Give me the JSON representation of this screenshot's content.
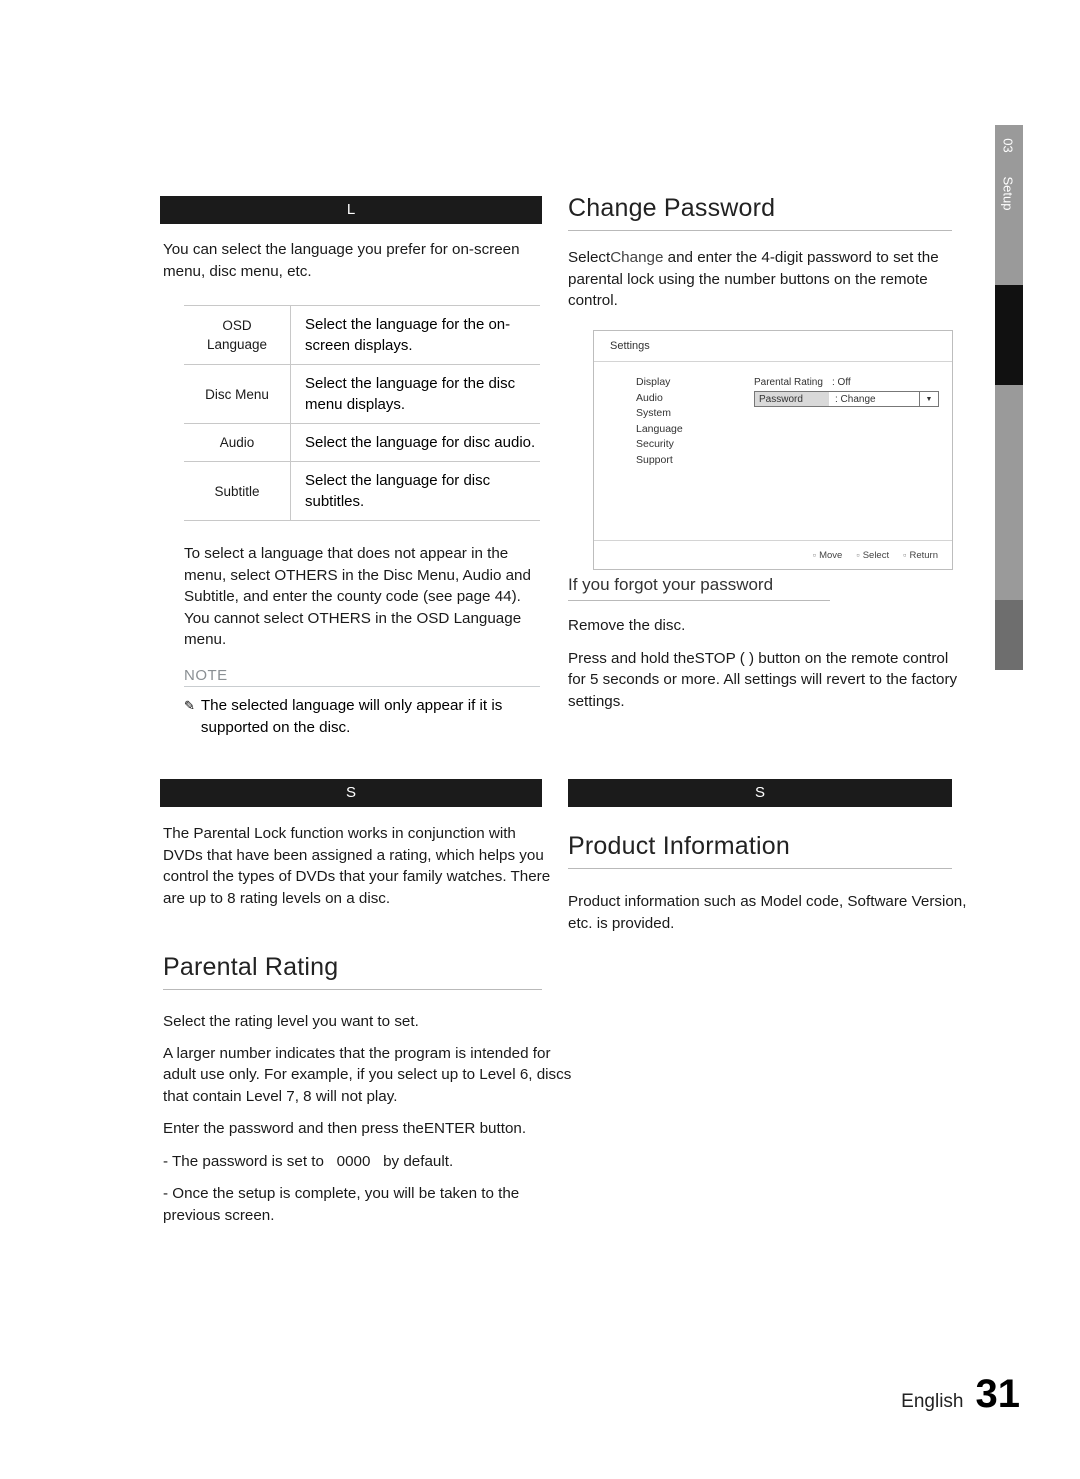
{
  "side_tab": {
    "number": "03",
    "label": "Setup"
  },
  "left": {
    "language_bar": "L",
    "intro": "You can select the language you prefer for on-screen menu, disc menu, etc.",
    "table": {
      "rows": [
        {
          "key": "OSD\nLanguage",
          "key_line1": "OSD",
          "key_line2": "Language",
          "value": "Select the language for the on-screen displays."
        },
        {
          "key": "Disc Menu",
          "key_line1": "Disc Menu",
          "key_line2": "",
          "value": "Select the language for the disc menu displays."
        },
        {
          "key": "Audio",
          "key_line1": "Audio",
          "key_line2": "",
          "value": "Select the language for disc audio."
        },
        {
          "key": "Subtitle",
          "key_line1": "Subtitle",
          "key_line2": "",
          "value": "Select the language for disc subtitles."
        }
      ]
    },
    "others_note": "To select a language that does not appear in the menu, select OTHERS in the Disc Menu, Audio and Subtitle, and enter the county code (see page 44). You cannot select OTHERS in the OSD Language menu.",
    "note_title": "NOTE",
    "note_glyph": "✎",
    "note_text": "The selected language will only appear if it is supported on the disc.",
    "security_bar": "S",
    "parental_intro": "The Parental Lock function works in conjunction with DVDs that have been assigned a rating, which helps you control the types of DVDs that your family watches. There are up to 8 rating levels on a disc.",
    "parental_rating_title": "Parental Rating",
    "parental_p1": "Select the rating level you want to set.",
    "parental_p2": "A larger number indicates that the program is intended for adult use only. For example, if you select up to Level 6, discs that contain Level 7, 8 will not play.",
    "parental_p3_a": "Enter the password and then press the",
    "parental_p3_enter": "ENTER",
    "parental_p3_b": "button.",
    "parental_b1_a": "- The password is set to",
    "parental_b1_val": "0000",
    "parental_b1_b": "by default.",
    "parental_b2": "- Once the setup is complete, you will be taken to the previous screen."
  },
  "right": {
    "change_password_title": "Change Password",
    "change_password_a": "Select",
    "change_password_em": "Change",
    "change_password_b": "and enter the 4-digit password to set the parental lock using the number buttons on the remote control.",
    "osd": {
      "title": "Settings",
      "menu": [
        "Display",
        "Audio",
        "System",
        "Language",
        "Security",
        "Support"
      ],
      "rows": [
        {
          "label": "Parental Rating",
          "value": ": Off",
          "highlighted": false
        },
        {
          "label": "Password",
          "value": ": Change",
          "highlighted": true
        }
      ],
      "caret": "▼",
      "footer": [
        {
          "glyph": "▫",
          "label": "Move"
        },
        {
          "glyph": "▫",
          "label": "Select"
        },
        {
          "glyph": "▫",
          "label": "Return"
        }
      ]
    },
    "forgot_title": "If you forgot your password",
    "forgot_p1": "Remove the disc.",
    "forgot_p2_a": "Press and hold the",
    "forgot_p2_stop": "STOP",
    "forgot_p2_paren": "(  )",
    "forgot_p2_b": "button on the remote control for 5 seconds or more. All settings will revert to the factory settings.",
    "support_bar": "S",
    "product_information_title": "Product Information",
    "product_information_text": "Product information such as Model code, Software Version, etc. is provided."
  },
  "footer": {
    "language": "English",
    "page": "31"
  }
}
